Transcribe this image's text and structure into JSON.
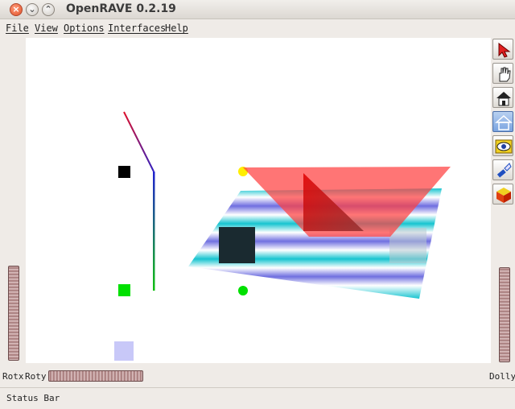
{
  "window": {
    "title": "OpenRAVE 0.2.19",
    "close_glyph": "×",
    "minimize_glyph": "⌄",
    "maximize_glyph": "⌃"
  },
  "menu": {
    "items": [
      "File",
      "View",
      "Options",
      "Interfaces",
      "Help"
    ]
  },
  "toolbar": {
    "tools": [
      {
        "icon": "select-arrow-icon",
        "active": false
      },
      {
        "icon": "pan-hand-icon",
        "active": false
      },
      {
        "icon": "home-icon",
        "active": false
      },
      {
        "icon": "set-home-icon",
        "active": true
      },
      {
        "icon": "view-all-eye-icon",
        "active": false
      },
      {
        "icon": "seek-flashlight-icon",
        "active": false
      },
      {
        "icon": "projection-cube-icon",
        "active": false
      }
    ]
  },
  "bottom": {
    "rotx_label": "Rotx",
    "roty_label": "Roty",
    "dolly_label": "Dolly"
  },
  "status": {
    "text": "Status Bar"
  },
  "colors": {
    "plane_cyan": "#17c4d0",
    "frustum_red": "#ff5050",
    "marker_green": "#00e000",
    "marker_yellow": "#ffee00"
  }
}
